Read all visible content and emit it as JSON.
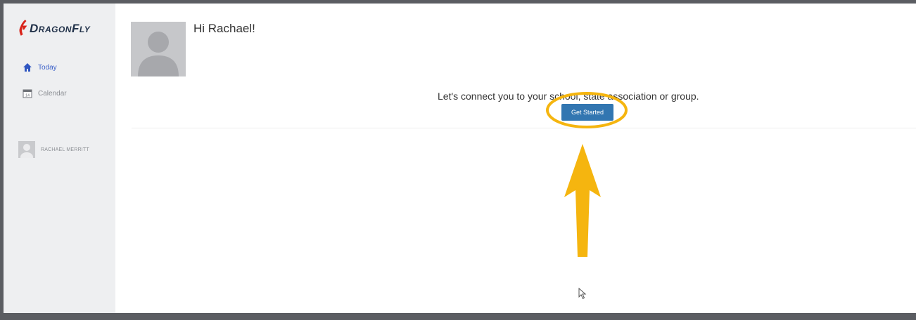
{
  "app": {
    "logo_text": "DragonFly"
  },
  "sidebar": {
    "items": [
      {
        "label": "Today",
        "icon": "home-icon",
        "active": true
      },
      {
        "label": "Calendar",
        "icon": "calendar-icon",
        "active": false
      }
    ],
    "user": {
      "name": "RACHAEL MERRITT",
      "icon": "avatar-icon"
    }
  },
  "main": {
    "greeting": "Hi Rachael!",
    "connect_prompt": "Let's connect you to your school, state association or group.",
    "get_started_label": "Get Started"
  },
  "annotation": {
    "color": "#f5b50f",
    "shapes": [
      "highlight-ellipse",
      "arrow-up"
    ]
  },
  "colors": {
    "primary_button": "#3276b1",
    "active_nav": "#3a5fc8",
    "logo_red": "#d9251c",
    "logo_dark": "#22324a"
  }
}
